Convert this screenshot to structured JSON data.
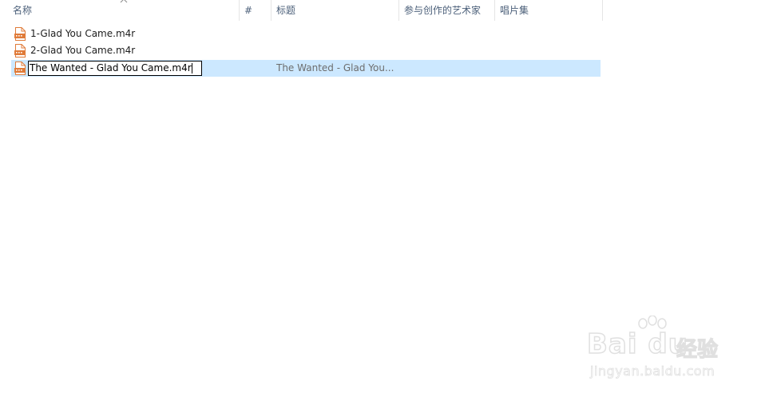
{
  "columns": {
    "name": "名称",
    "number": "#",
    "title": "标题",
    "artist": "参与创作的艺术家",
    "album": "唱片集"
  },
  "files": [
    {
      "name": "1-Glad You Came.m4r",
      "title": ""
    },
    {
      "name": "2-Glad You Came.m4r",
      "title": ""
    },
    {
      "name": "The Wanted - Glad You Came.m4r",
      "title": "The Wanted - Glad You...",
      "selected": true,
      "renaming": true
    }
  ],
  "watermark": {
    "brand": "Bai du",
    "brand_cn": "经验",
    "url": "jingyan.baidu.com"
  },
  "colors": {
    "selection": "#cce8ff",
    "header_text": "#4c607a",
    "file_icon": "#e07b39"
  }
}
